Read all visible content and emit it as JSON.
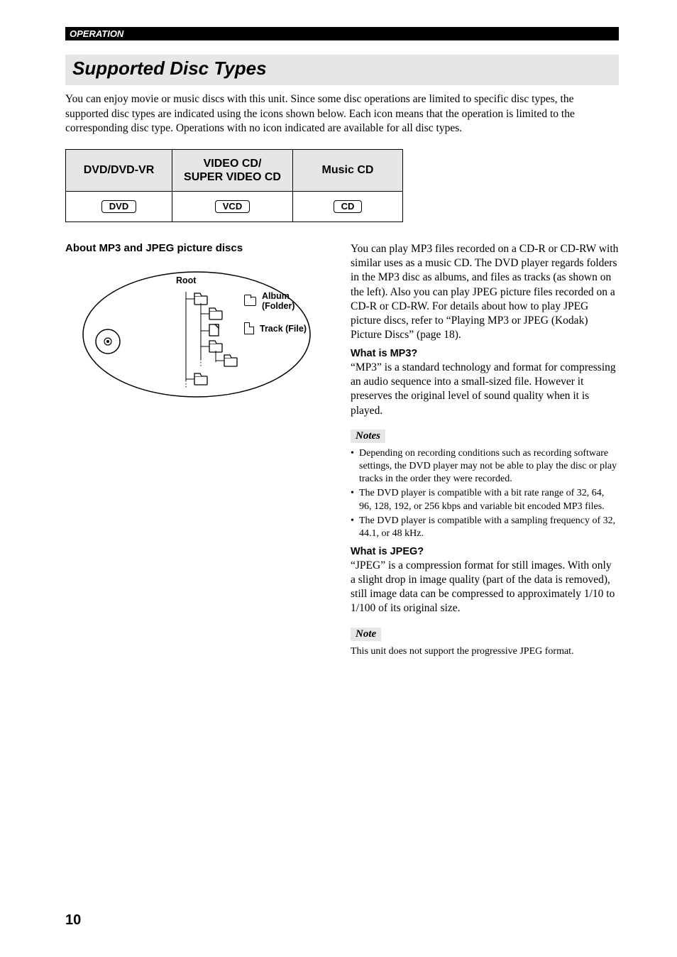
{
  "operation_label": "OPERATION",
  "title": "Supported Disc Types",
  "intro": "You can enjoy movie or music discs with this unit. Since some disc operations are limited to specific disc types, the supported disc types are indicated using the icons shown below. Each icon means that the operation is limited to the corresponding disc type. Operations with no icon indicated are available for all disc types.",
  "table": {
    "headers": [
      "DVD/DVD-VR",
      "VIDEO CD/\nSUPER VIDEO CD",
      "Music CD"
    ],
    "chips": [
      "DVD",
      "VCD",
      "CD"
    ]
  },
  "left": {
    "heading": "About MP3 and JPEG picture discs",
    "diagram": {
      "root_label": "Root",
      "legend_album": "Album (Folder)",
      "legend_track": "Track (File)"
    }
  },
  "right": {
    "p1": "You can play MP3 files recorded on a CD-R or CD-RW with similar uses as a music CD. The DVD player regards folders in the MP3 disc as albums, and files as tracks (as shown on the left). Also you can play JPEG picture files recorded on a CD-R or CD-RW. For details about how to play JPEG picture discs, refer to “Playing MP3 or JPEG (Kodak) Picture Discs” (page 18).",
    "q1_head": "What is MP3?",
    "q1_body": "“MP3” is a standard technology and format for compressing an audio sequence into a small-sized file. However it preserves the original level of sound quality when it is played.",
    "notes_label": "Notes",
    "notes": [
      "Depending on recording conditions such as recording software settings, the DVD player may not be able to play the disc or play tracks in the order they were recorded.",
      "The DVD player is compatible with a bit rate range of 32, 64, 96, 128, 192, or 256 kbps and variable bit encoded MP3 files.",
      "The DVD player is compatible with a sampling frequency of 32, 44.1, or 48 kHz."
    ],
    "q2_head": "What is JPEG?",
    "q2_body": "“JPEG” is a compression format for still images. With only a slight drop in image quality (part of the data is removed), still image data can be compressed to approximately 1/10 to 1/100 of its original size.",
    "note_label": "Note",
    "note_body": "This unit does not support the progressive JPEG format."
  },
  "page_number": "10"
}
